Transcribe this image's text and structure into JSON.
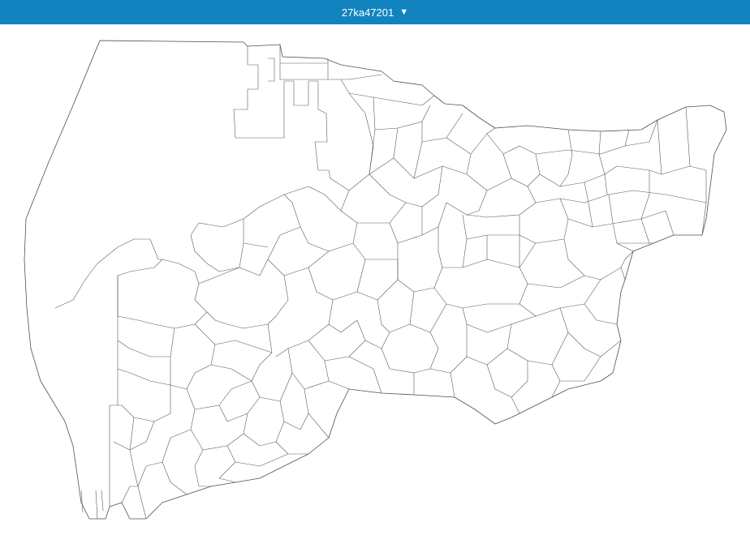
{
  "header": {
    "region_code": "27ka47201",
    "dropdown_caret": "▼",
    "background_color": "#1184bf",
    "text_color": "#ffffff"
  },
  "map": {
    "fill_color": "#ffffff",
    "stroke_color": "#555a66"
  }
}
